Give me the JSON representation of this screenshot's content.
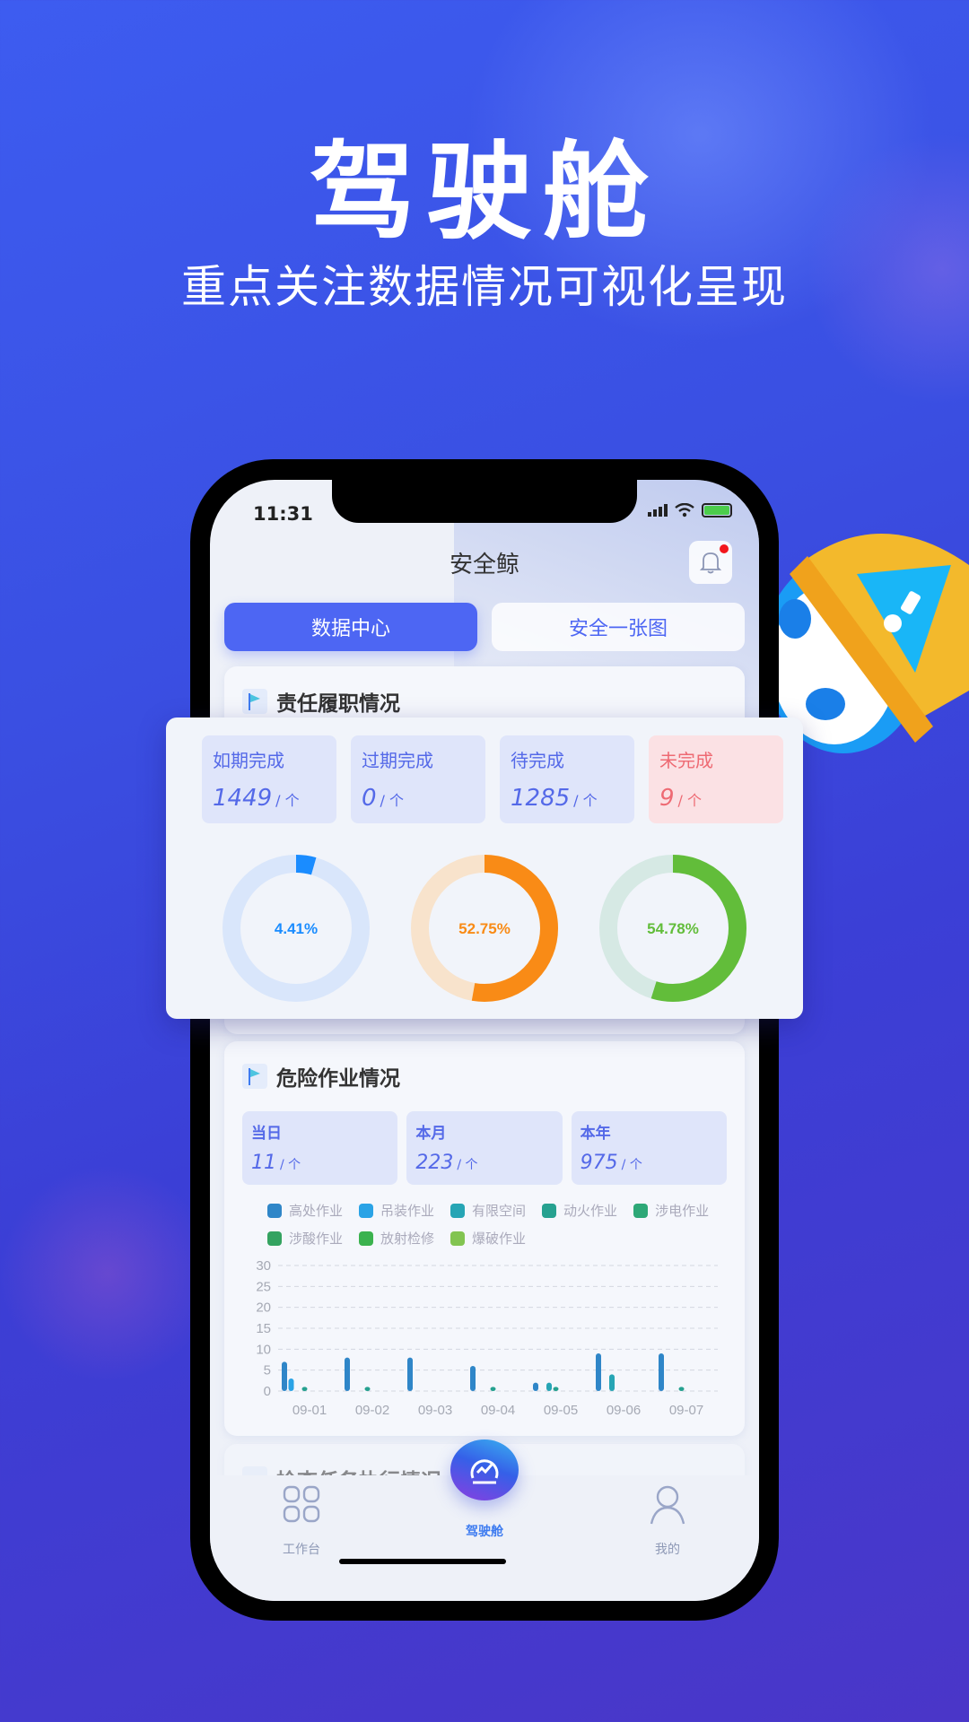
{
  "promo": {
    "headline": "驾驶舱",
    "subline": "重点关注数据情况可视化呈现"
  },
  "status_bar": {
    "time": "11:31"
  },
  "app": {
    "title": "安全鲸",
    "notification_badge": true,
    "tabs": [
      {
        "label": "数据中心",
        "active": true
      },
      {
        "label": "安全一张图",
        "active": false
      }
    ]
  },
  "responsibility": {
    "title": "责任履职情况",
    "stats": [
      {
        "label": "如期完成",
        "value": "1449",
        "unit": "/ 个",
        "tone": "blue"
      },
      {
        "label": "过期完成",
        "value": "0",
        "unit": "/ 个",
        "tone": "blue"
      },
      {
        "label": "待完成",
        "value": "1285",
        "unit": "/ 个",
        "tone": "blue"
      },
      {
        "label": "未完成",
        "value": "9",
        "unit": "/ 个",
        "tone": "red"
      }
    ],
    "rings": [
      {
        "label": "4.41%",
        "percent": 4.41,
        "color": "#1a8cff",
        "track": "#d9e6fb"
      },
      {
        "label": "52.75%",
        "percent": 52.75,
        "color": "#f98b16",
        "track": "#f8e3cc"
      },
      {
        "label": "54.78%",
        "percent": 54.78,
        "color": "#62bd3a",
        "track": "#d6e9e4"
      }
    ]
  },
  "hazard": {
    "title": "危险作业情况",
    "stats": [
      {
        "label": "当日",
        "value": "11",
        "unit": "/ 个"
      },
      {
        "label": "本月",
        "value": "223",
        "unit": "/ 个"
      },
      {
        "label": "本年",
        "value": "975",
        "unit": "/ 个"
      }
    ]
  },
  "chart_data": {
    "type": "bar",
    "title": "",
    "xlabel": "",
    "ylabel": "",
    "ylim": [
      0,
      30
    ],
    "yticks": [
      0,
      5,
      10,
      15,
      20,
      25,
      30
    ],
    "grid": true,
    "legend_position": "top",
    "categories": [
      "09-01",
      "09-02",
      "09-03",
      "09-04",
      "09-05",
      "09-06",
      "09-07"
    ],
    "series": [
      {
        "name": "高处作业",
        "color": "#2f86c8",
        "values": [
          7,
          8,
          8,
          6,
          2,
          9,
          9
        ]
      },
      {
        "name": "吊装作业",
        "color": "#2aa3e6",
        "values": [
          3,
          0,
          0,
          0,
          0,
          0,
          0
        ]
      },
      {
        "name": "有限空间",
        "color": "#26a5b5",
        "values": [
          0,
          0,
          0,
          0,
          2,
          4,
          0
        ]
      },
      {
        "name": "动火作业",
        "color": "#26a190",
        "values": [
          1,
          1,
          0,
          1,
          1,
          0,
          1
        ]
      },
      {
        "name": "涉电作业",
        "color": "#2da877",
        "values": [
          0,
          0,
          0,
          0,
          0,
          0,
          0
        ]
      },
      {
        "name": "涉酸作业",
        "color": "#34a360",
        "values": [
          0,
          0,
          0,
          0,
          0,
          0,
          0
        ]
      },
      {
        "name": "放射检修",
        "color": "#3bb24e",
        "values": [
          0,
          0,
          0,
          0,
          0,
          0,
          0
        ]
      },
      {
        "name": "爆破作业",
        "color": "#82c451",
        "values": [
          0,
          0,
          0,
          0,
          0,
          0,
          0
        ]
      }
    ]
  },
  "next_section": {
    "title": "检查任务执行情况"
  },
  "bottom_nav": [
    {
      "label": "工作台",
      "icon": "grid-icon",
      "active": false
    },
    {
      "label": "驾驶舱",
      "icon": "dashboard-gauge-icon",
      "active": true
    },
    {
      "label": "我的",
      "icon": "user-icon",
      "active": false
    }
  ]
}
